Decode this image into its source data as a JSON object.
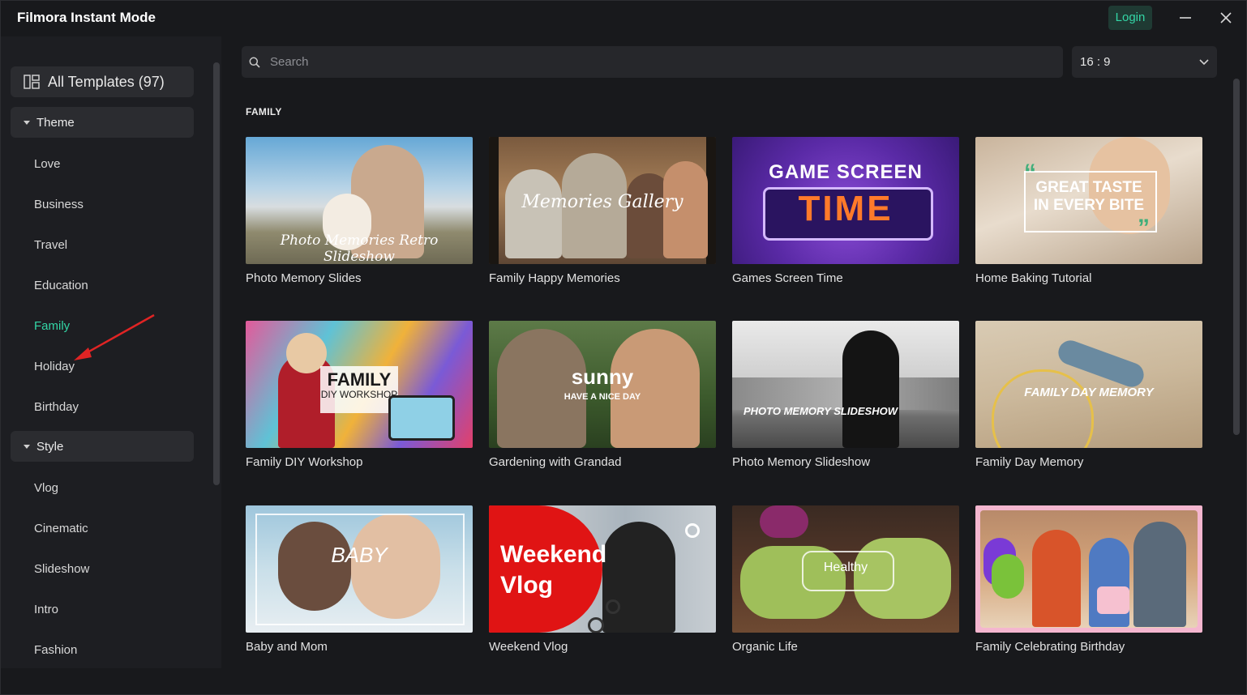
{
  "app": {
    "title": "Filmora Instant Mode",
    "login_label": "Login"
  },
  "sidebar": {
    "all_templates_label": "All Templates (97)",
    "theme_header": "Theme",
    "theme_items": [
      "Love",
      "Business",
      "Travel",
      "Education",
      "Family",
      "Holiday",
      "Birthday"
    ],
    "active_item": "Family",
    "style_header": "Style",
    "style_items": [
      "Vlog",
      "Cinematic",
      "Slideshow",
      "Intro",
      "Fashion"
    ]
  },
  "search": {
    "placeholder": "Search",
    "value": ""
  },
  "ratio_select": {
    "value": "16 : 9"
  },
  "section": {
    "title": "FAMILY"
  },
  "templates": [
    {
      "title": "Photo Memory Slides",
      "overlay": "Photo Memories Retro Slideshow"
    },
    {
      "title": "Family Happy Memories",
      "overlay": "Memories Gallery"
    },
    {
      "title": "Games Screen Time",
      "overlay": "GAME SCREEN",
      "overlay2": "TIME"
    },
    {
      "title": "Home Baking Tutorial",
      "overlay": "GREAT TASTE",
      "overlay2": "IN EVERY BITE"
    },
    {
      "title": "Family DIY Workshop",
      "overlay": "FAMILY",
      "overlay2": "DIY WORKSHOP"
    },
    {
      "title": "Gardening with Grandad",
      "overlay": "sunny",
      "overlay2": "HAVE A NICE DAY"
    },
    {
      "title": "Photo Memory Slideshow",
      "overlay": "PHOTO MEMORY SLIDESHOW"
    },
    {
      "title": "Family Day Memory",
      "overlay": "FAMILY DAY MEMORY"
    },
    {
      "title": "Baby and Mom",
      "overlay": "BABY"
    },
    {
      "title": "Weekend Vlog",
      "overlay": "Weekend",
      "overlay2": "Vlog"
    },
    {
      "title": "Organic Life",
      "overlay": "Healthy"
    },
    {
      "title": "Family Celebrating Birthday",
      "overlay": ""
    }
  ],
  "colors": {
    "accent": "#33d6a6",
    "background": "#18191c",
    "panel": "#1d1e22",
    "annotation_arrow": "#e02424"
  }
}
